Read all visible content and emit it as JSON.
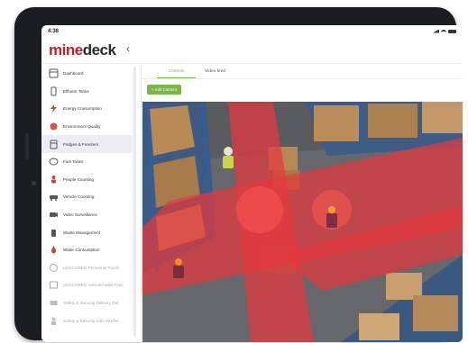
{
  "status_bar": {
    "time": "4:38"
  },
  "app": {
    "logo_part1": "mine",
    "logo_part2": "deck",
    "back_icon": "chevron-left-icon"
  },
  "sidebar": {
    "items": [
      {
        "label": "Dashboard",
        "icon": "dashboard-icon",
        "state": "normal"
      },
      {
        "label": "Effluent Tanks",
        "icon": "tank-icon",
        "state": "normal"
      },
      {
        "label": "Energy Consumption",
        "icon": "energy-icon",
        "state": "normal"
      },
      {
        "label": "Environment Quality",
        "icon": "leaf-icon",
        "state": "normal"
      },
      {
        "label": "Fridges & Freezers",
        "icon": "fridge-icon",
        "state": "active"
      },
      {
        "label": "Fuel Tanks",
        "icon": "fuel-icon",
        "state": "normal"
      },
      {
        "label": "People Counting",
        "icon": "people-icon",
        "state": "normal"
      },
      {
        "label": "Vehicle Counting",
        "icon": "vehicle-icon",
        "state": "normal"
      },
      {
        "label": "Video Surveillance",
        "icon": "camera-icon",
        "state": "normal"
      },
      {
        "label": "Waste Management",
        "icon": "bin-icon",
        "state": "normal"
      },
      {
        "label": "Water Consumption",
        "icon": "water-icon",
        "state": "normal"
      },
      {
        "label": "UNSCORED Personnel Tracki",
        "icon": "personnel-icon",
        "state": "disabled"
      },
      {
        "label": "UNSCORED Vehicle/Asset Traci",
        "icon": "asset-icon",
        "state": "disabled"
      },
      {
        "label": "Safety & Security Delivery Det",
        "icon": "delivery-icon",
        "state": "disabled"
      },
      {
        "label": "Safety & Security Safe Worker",
        "icon": "worker-icon",
        "state": "disabled"
      }
    ]
  },
  "main": {
    "tabs": [
      {
        "label": "Controls",
        "active": true
      },
      {
        "label": "Video feed",
        "active": false
      }
    ],
    "add_button_label": "+ Add Camera"
  },
  "colors": {
    "brand_red": "#b8242a",
    "accent_green": "#7ab648",
    "heatmap_red": "#e5393f"
  }
}
